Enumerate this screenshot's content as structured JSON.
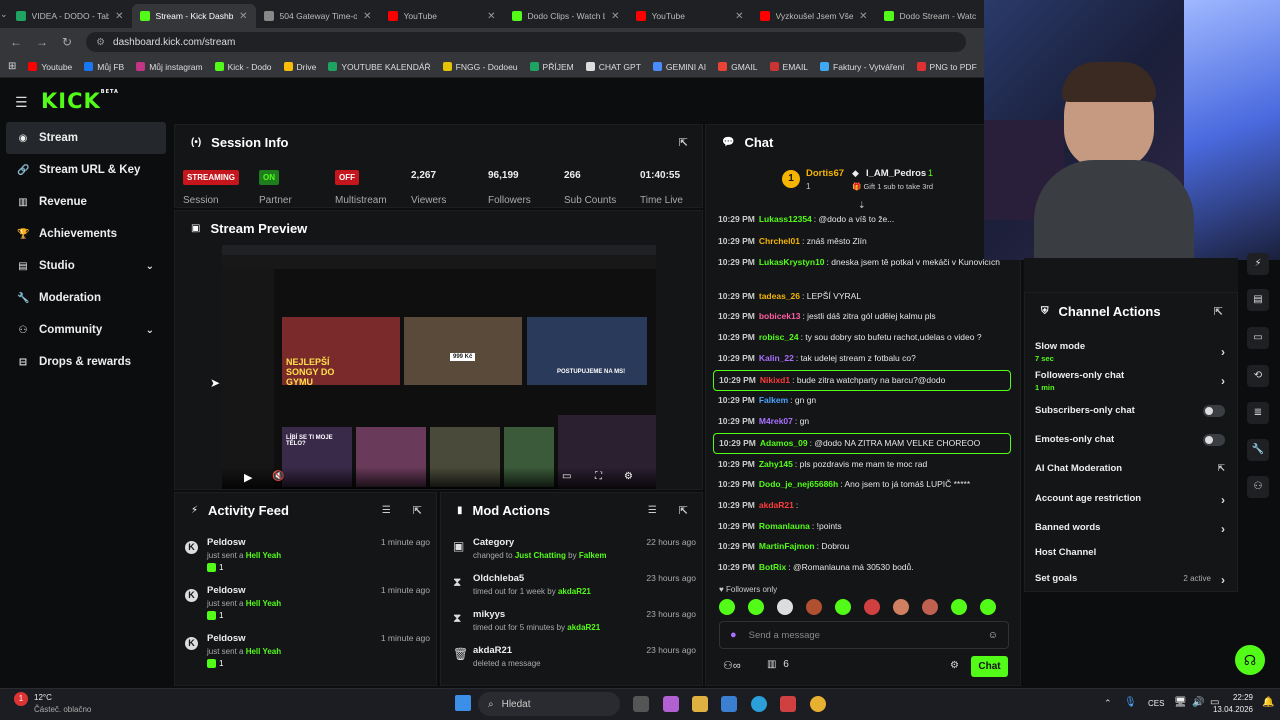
{
  "browser": {
    "tabs": [
      {
        "title": "VIDEA - DODO - Tab",
        "color": "#1ea362",
        "active": false
      },
      {
        "title": "Stream - Kick Dashb",
        "color": "#53fc18",
        "active": true
      },
      {
        "title": "504 Gateway Time-ou",
        "color": "#888888",
        "active": false
      },
      {
        "title": "YouTube",
        "color": "#ff0000",
        "active": false
      },
      {
        "title": "Dodo Clips - Watch L",
        "color": "#53fc18",
        "active": false
      },
      {
        "title": "YouTube",
        "color": "#ff0000",
        "active": false
      },
      {
        "title": "Vyzkoušel Jsem Vše",
        "color": "#ff0000",
        "active": false
      },
      {
        "title": "Dodo Stream - Watc",
        "color": "#53fc18",
        "active": false
      }
    ],
    "url": "dashboard.kick.com/stream",
    "bookmarks": [
      {
        "label": "Youtube",
        "color": "#ff0000"
      },
      {
        "label": "Můj FB",
        "color": "#1877f2"
      },
      {
        "label": "Můj instagram",
        "color": "#c13584"
      },
      {
        "label": "Kick - Dodo",
        "color": "#53fc18"
      },
      {
        "label": "Drive",
        "color": "#fbbc04"
      },
      {
        "label": "YOUTUBE KALENDÁŘ",
        "color": "#1ea362"
      },
      {
        "label": "FNGG - Dodoeu",
        "color": "#e6c300"
      },
      {
        "label": "PŘÍJEM",
        "color": "#1ea362"
      },
      {
        "label": "CHAT GPT",
        "color": "#dddddd"
      },
      {
        "label": "GEMINI AI",
        "color": "#4a8cff"
      },
      {
        "label": "GMAIL",
        "color": "#ea4335"
      },
      {
        "label": "EMAIL",
        "color": "#cc3333"
      },
      {
        "label": "Faktury - Vytváření",
        "color": "#3fa9f5"
      },
      {
        "label": "PNG to PDF",
        "color": "#e03030"
      }
    ]
  },
  "kick": {
    "logo": "KICK",
    "beta": "BETA"
  },
  "sidebar": {
    "items": [
      {
        "label": "Stream",
        "icon": "radio-icon",
        "glyph": "◉"
      },
      {
        "label": "Stream URL & Key",
        "icon": "link-icon",
        "glyph": "🔗"
      },
      {
        "label": "Revenue",
        "icon": "chart-icon",
        "glyph": "▥"
      },
      {
        "label": "Achievements",
        "icon": "trophy-icon",
        "glyph": "🏆"
      },
      {
        "label": "Studio",
        "icon": "studio-icon",
        "glyph": "▤"
      },
      {
        "label": "Moderation",
        "icon": "wrench-icon",
        "glyph": "🔧"
      },
      {
        "label": "Community",
        "icon": "community-icon",
        "glyph": "⚇"
      },
      {
        "label": "Drops & rewards",
        "icon": "gift-icon",
        "glyph": "⊟"
      }
    ]
  },
  "session": {
    "title": "Session Info",
    "stats": [
      {
        "value": "STREAMING",
        "label": "Session"
      },
      {
        "value": "ON",
        "label": "Partner"
      },
      {
        "value": "OFF",
        "label": "Multistream"
      },
      {
        "value": "2,267",
        "label": "Viewers"
      },
      {
        "value": "96,199",
        "label": "Followers"
      },
      {
        "value": "266",
        "label": "Sub Counts"
      },
      {
        "value": "01:40:55",
        "label": "Time Live"
      }
    ]
  },
  "preview": {
    "title": "Stream Preview",
    "thumbnails": [
      "NEJLEPŠÍ SONGY DO GYMU",
      "999 Kč",
      "POSTUPUJEME NA MS!",
      "LÍBÍ SE TI MOJE TĚLO?"
    ]
  },
  "activity": {
    "title": "Activity Feed",
    "items": [
      {
        "user": "Peldosw",
        "time": "1 minute ago",
        "pre": "just sent a",
        "item": "Hell Yeah",
        "count": "1"
      },
      {
        "user": "Peldosw",
        "time": "1 minute ago",
        "pre": "just sent a",
        "item": "Hell Yeah",
        "count": "1"
      },
      {
        "user": "Peldosw",
        "time": "1 minute ago",
        "pre": "just sent a",
        "item": "Hell Yeah",
        "count": "1"
      }
    ]
  },
  "mod": {
    "title": "Mod Actions",
    "items": [
      {
        "name": "Category",
        "time": "22 hours ago",
        "desc": "changed to",
        "hl1": "Just Chatting",
        "mid": "by",
        "hl2": "Falkem"
      },
      {
        "name": "Oldchleba5",
        "time": "23 hours ago",
        "desc": "timed out for 1 week by",
        "hl1": "",
        "mid": "",
        "hl2": "akdaR21"
      },
      {
        "name": "mikyys",
        "time": "23 hours ago",
        "desc": "timed out for 5 minutes by",
        "hl1": "",
        "mid": "",
        "hl2": "akdaR21"
      },
      {
        "name": "akdaR21",
        "time": "23 hours ago",
        "desc": "deleted a message",
        "hl1": "",
        "mid": "",
        "hl2": ""
      }
    ]
  },
  "chat": {
    "title": "Chat",
    "top": {
      "user1": "Dortis67",
      "user1count": "1",
      "user2": "I_AM_Pedros",
      "user2count": "1",
      "gift": "Gift 1 sub to take 3rd"
    },
    "messages": [
      {
        "time": "10:29 PM",
        "user": "Lukass12354",
        "color": "#53fc18",
        "text": "@dodo a víš to že...",
        "hl": false
      },
      {
        "time": "10:29 PM",
        "user": "Chrchel01",
        "color": "#f4b400",
        "text": "znáš město Zlín",
        "hl": false
      },
      {
        "time": "10:29 PM",
        "user": "LukasKrystyn10",
        "color": "#53fc18",
        "text": "dneska jsem tě potkal v mekáči v Kunovicích",
        "hl": false
      },
      {
        "time": "10:29 PM",
        "user": "tadeas_26",
        "color": "#f4b400",
        "text": "LEPŠÍ VYRAL",
        "hl": false
      },
      {
        "time": "10:29 PM",
        "user": "bobicek13",
        "color": "#ff5da2",
        "text": "jestli dáš zitra gól udělej kalmu pls",
        "hl": false
      },
      {
        "time": "10:29 PM",
        "user": "robisc_24",
        "color": "#53fc18",
        "text": "ty sou dobry sto bufetu rachot,udelas o video ?",
        "hl": false
      },
      {
        "time": "10:29 PM",
        "user": "Kalin_22",
        "color": "#a970ff",
        "text": "tak udelej stream z fotbalu co?",
        "hl": false
      },
      {
        "time": "10:29 PM",
        "user": "Nikixd1",
        "color": "#ff3b3b",
        "text": "bude zitra watchparty na barcu?@dodo",
        "hl": true
      },
      {
        "time": "10:29 PM",
        "user": "Falkem",
        "color": "#4aa3ff",
        "text": "gn gn",
        "hl": false
      },
      {
        "time": "10:29 PM",
        "user": "M4rek07",
        "color": "#a970ff",
        "text": "gn",
        "hl": false
      },
      {
        "time": "10:29 PM",
        "user": "Adamos_09",
        "color": "#53fc18",
        "text": "@dodo NA ZITRA MAM VELKE CHOREOO",
        "hl": true
      },
      {
        "time": "10:29 PM",
        "user": "Zahy145",
        "color": "#53fc18",
        "text": "pls pozdravis me mam te moc rad",
        "hl": false
      },
      {
        "time": "10:29 PM",
        "user": "Dodo_je_nej65686h",
        "color": "#53fc18",
        "text": "Ano jsem to já tomáš LUPIČ *****",
        "hl": false
      },
      {
        "time": "10:29 PM",
        "user": "akdaR21",
        "color": "#ff3b3b",
        "text": "",
        "hl": false
      },
      {
        "time": "10:29 PM",
        "user": "Romanlauna",
        "color": "#53fc18",
        "text": "!points",
        "hl": false
      },
      {
        "time": "10:29 PM",
        "user": "MartinFajmon",
        "color": "#53fc18",
        "text": "Dobrou",
        "hl": false
      },
      {
        "time": "10:29 PM",
        "user": "BotRix",
        "color": "#53fc18",
        "text": "@Romanlauna má 30530 bodů.",
        "hl": false
      }
    ],
    "followers_only": "Followers only",
    "placeholder": "Send a message",
    "viewers": "6",
    "send": "Chat"
  },
  "actions": {
    "title": "Channel Actions",
    "items": [
      {
        "label": "Slow mode",
        "sub": "7 sec",
        "kind": "chevron"
      },
      {
        "label": "Followers-only chat",
        "sub": "1 min",
        "kind": "chevron"
      },
      {
        "label": "Subscribers-only chat",
        "sub": "",
        "kind": "toggle"
      },
      {
        "label": "Emotes-only chat",
        "sub": "",
        "kind": "toggle"
      },
      {
        "label": "AI Chat Moderation",
        "sub": "",
        "kind": "external"
      },
      {
        "label": "Account age restriction",
        "sub": "",
        "kind": "chevron"
      },
      {
        "label": "Banned words",
        "sub": "",
        "kind": "chevron"
      },
      {
        "label": "Host Channel",
        "sub": "",
        "kind": "none"
      },
      {
        "label": "Set goals",
        "sub": "",
        "kind": "chevron",
        "extra": "2 active"
      }
    ]
  },
  "taskbar": {
    "temp": "12°C",
    "weather": "Částeč. oblačno",
    "search": "Hledat",
    "lang": "CES",
    "time": "22:29",
    "date": "13.04.2026"
  }
}
